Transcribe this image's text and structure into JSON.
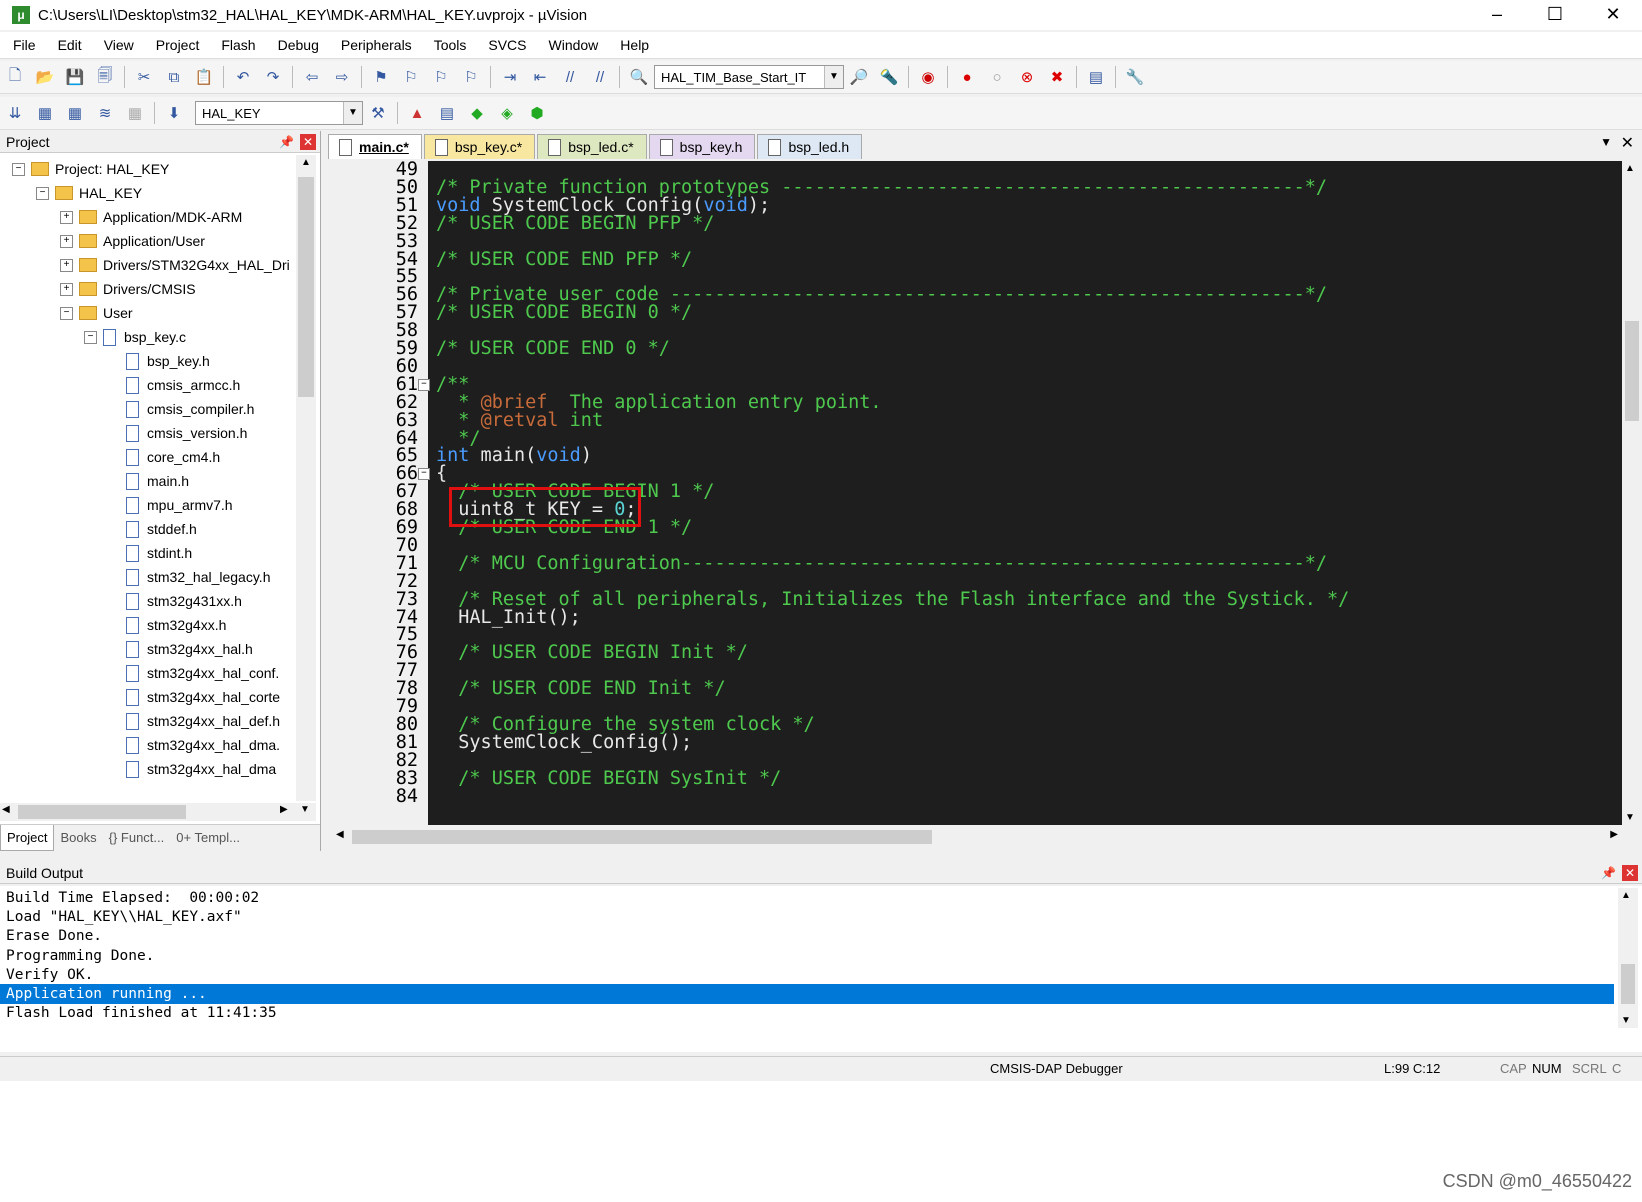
{
  "window": {
    "title": "C:\\Users\\LI\\Desktop\\stm32_HAL\\HAL_KEY\\MDK-ARM\\HAL_KEY.uvprojx - µVision",
    "minimize": "–",
    "maximize": "☐",
    "close": "✕"
  },
  "menu": [
    "File",
    "Edit",
    "View",
    "Project",
    "Flash",
    "Debug",
    "Peripherals",
    "Tools",
    "SVCS",
    "Window",
    "Help"
  ],
  "toolbar": {
    "function_combo": "HAL_TIM_Base_Start_IT",
    "target_combo": "HAL_KEY"
  },
  "project_panel": {
    "title": "Project",
    "tree": [
      {
        "label": "Project: HAL_KEY",
        "level": 0,
        "type": "project",
        "exp": "−"
      },
      {
        "label": "HAL_KEY",
        "level": 1,
        "type": "folder",
        "exp": "−"
      },
      {
        "label": "Application/MDK-ARM",
        "level": 2,
        "type": "folder",
        "exp": "+"
      },
      {
        "label": "Application/User",
        "level": 2,
        "type": "folder",
        "exp": "+"
      },
      {
        "label": "Drivers/STM32G4xx_HAL_Dri",
        "level": 2,
        "type": "folder",
        "exp": "+"
      },
      {
        "label": "Drivers/CMSIS",
        "level": 2,
        "type": "folder",
        "exp": "+"
      },
      {
        "label": "User",
        "level": 2,
        "type": "folder",
        "exp": "−"
      },
      {
        "label": "bsp_key.c",
        "level": 3,
        "type": "file",
        "exp": "−"
      },
      {
        "label": "bsp_key.h",
        "level": 4,
        "type": "file"
      },
      {
        "label": "cmsis_armcc.h",
        "level": 4,
        "type": "file"
      },
      {
        "label": "cmsis_compiler.h",
        "level": 4,
        "type": "file"
      },
      {
        "label": "cmsis_version.h",
        "level": 4,
        "type": "file"
      },
      {
        "label": "core_cm4.h",
        "level": 4,
        "type": "file"
      },
      {
        "label": "main.h",
        "level": 4,
        "type": "file"
      },
      {
        "label": "mpu_armv7.h",
        "level": 4,
        "type": "file"
      },
      {
        "label": "stddef.h",
        "level": 4,
        "type": "file"
      },
      {
        "label": "stdint.h",
        "level": 4,
        "type": "file"
      },
      {
        "label": "stm32_hal_legacy.h",
        "level": 4,
        "type": "file"
      },
      {
        "label": "stm32g431xx.h",
        "level": 4,
        "type": "file"
      },
      {
        "label": "stm32g4xx.h",
        "level": 4,
        "type": "file"
      },
      {
        "label": "stm32g4xx_hal.h",
        "level": 4,
        "type": "file"
      },
      {
        "label": "stm32g4xx_hal_conf.",
        "level": 4,
        "type": "file"
      },
      {
        "label": "stm32g4xx_hal_corte",
        "level": 4,
        "type": "file"
      },
      {
        "label": "stm32g4xx_hal_def.h",
        "level": 4,
        "type": "file"
      },
      {
        "label": "stm32g4xx_hal_dma.",
        "level": 4,
        "type": "file"
      },
      {
        "label": "stm32g4xx_hal_dma",
        "level": 4,
        "type": "file"
      }
    ],
    "tabs": [
      "Project",
      "Books",
      "{} Funct...",
      "0+ Templ..."
    ]
  },
  "editor": {
    "tabs": [
      {
        "label": "main.c*",
        "color": "#f7e7a0",
        "active": true
      },
      {
        "label": "bsp_key.c*",
        "color": "#f7e7a0"
      },
      {
        "label": "bsp_led.c*",
        "color": "#dde8c0"
      },
      {
        "label": "bsp_key.h",
        "color": "#e4d8f0"
      },
      {
        "label": "bsp_led.h",
        "color": "#dde8f4"
      }
    ],
    "lines": [
      {
        "n": "49",
        "fold": "",
        "segs": []
      },
      {
        "n": "50",
        "fold": "",
        "segs": [
          [
            "c-comment",
            "/* Private function prototypes -----------------------------------------------*/"
          ]
        ]
      },
      {
        "n": "51",
        "fold": "",
        "segs": [
          [
            "c-kw",
            "void"
          ],
          [
            "c-plain",
            " SystemClock_Config("
          ],
          [
            "c-kw",
            "void"
          ],
          [
            "c-plain",
            ");"
          ]
        ]
      },
      {
        "n": "52",
        "fold": "",
        "segs": [
          [
            "c-comment",
            "/* USER CODE BEGIN PFP */"
          ]
        ]
      },
      {
        "n": "53",
        "fold": "",
        "segs": []
      },
      {
        "n": "54",
        "fold": "",
        "segs": [
          [
            "c-comment",
            "/* USER CODE END PFP */"
          ]
        ]
      },
      {
        "n": "55",
        "fold": "",
        "segs": []
      },
      {
        "n": "56",
        "fold": "",
        "segs": [
          [
            "c-comment",
            "/* Private user code ---------------------------------------------------------*/"
          ]
        ]
      },
      {
        "n": "57",
        "fold": "",
        "segs": [
          [
            "c-comment",
            "/* USER CODE BEGIN 0 */"
          ]
        ]
      },
      {
        "n": "58",
        "fold": "",
        "segs": []
      },
      {
        "n": "59",
        "fold": "",
        "segs": [
          [
            "c-comment",
            "/* USER CODE END 0 */"
          ]
        ]
      },
      {
        "n": "60",
        "fold": "",
        "segs": []
      },
      {
        "n": "61",
        "fold": "−",
        "segs": [
          [
            "c-comment",
            "/**"
          ]
        ]
      },
      {
        "n": "62",
        "fold": "",
        "segs": [
          [
            "c-comment",
            "  * "
          ],
          [
            "c-tag",
            "@brief"
          ],
          [
            "c-comment",
            "  The application entry point."
          ]
        ]
      },
      {
        "n": "63",
        "fold": "",
        "segs": [
          [
            "c-comment",
            "  * "
          ],
          [
            "c-tag",
            "@retval"
          ],
          [
            "c-comment",
            " int"
          ]
        ]
      },
      {
        "n": "64",
        "fold": "",
        "segs": [
          [
            "c-comment",
            "  */"
          ]
        ]
      },
      {
        "n": "65",
        "fold": "",
        "segs": [
          [
            "c-kw",
            "int"
          ],
          [
            "c-plain",
            " main("
          ],
          [
            "c-kw",
            "void"
          ],
          [
            "c-plain",
            ")"
          ]
        ]
      },
      {
        "n": "66",
        "fold": "−",
        "segs": [
          [
            "c-plain",
            "{"
          ]
        ]
      },
      {
        "n": "67",
        "fold": "",
        "segs": [
          [
            "c-comment",
            "  /* USER CODE BEGIN 1 */"
          ]
        ]
      },
      {
        "n": "68",
        "fold": "",
        "segs": [
          [
            "c-plain",
            "  uint8_t KEY = "
          ],
          [
            "c-num",
            "0"
          ],
          [
            "c-plain",
            ";"
          ]
        ]
      },
      {
        "n": "69",
        "fold": "",
        "segs": [
          [
            "c-comment",
            "  /* USER CODE END 1 */"
          ]
        ]
      },
      {
        "n": "70",
        "fold": "",
        "segs": []
      },
      {
        "n": "71",
        "fold": "",
        "segs": [
          [
            "c-comment",
            "  /* MCU Configuration--------------------------------------------------------*/"
          ]
        ]
      },
      {
        "n": "72",
        "fold": "",
        "segs": []
      },
      {
        "n": "73",
        "fold": "",
        "segs": [
          [
            "c-comment",
            "  /* Reset of all peripherals, Initializes the Flash interface and the Systick. */"
          ]
        ]
      },
      {
        "n": "74",
        "fold": "",
        "segs": [
          [
            "c-plain",
            "  HAL_Init();"
          ]
        ]
      },
      {
        "n": "75",
        "fold": "",
        "segs": []
      },
      {
        "n": "76",
        "fold": "",
        "segs": [
          [
            "c-comment",
            "  /* USER CODE BEGIN Init */"
          ]
        ]
      },
      {
        "n": "77",
        "fold": "",
        "segs": []
      },
      {
        "n": "78",
        "fold": "",
        "segs": [
          [
            "c-comment",
            "  /* USER CODE END Init */"
          ]
        ]
      },
      {
        "n": "79",
        "fold": "",
        "segs": []
      },
      {
        "n": "80",
        "fold": "",
        "segs": [
          [
            "c-comment",
            "  /* Configure the system clock */"
          ]
        ]
      },
      {
        "n": "81",
        "fold": "",
        "segs": [
          [
            "c-plain",
            "  SystemClock_Config();"
          ]
        ]
      },
      {
        "n": "82",
        "fold": "",
        "segs": []
      },
      {
        "n": "83",
        "fold": "",
        "segs": [
          [
            "c-comment",
            "  /* USER CODE BEGIN SysInit */"
          ]
        ]
      },
      {
        "n": "84",
        "fold": "",
        "segs": []
      }
    ]
  },
  "build_output": {
    "title": "Build Output",
    "lines": [
      "Build Time Elapsed:  00:00:02",
      "Load \"HAL_KEY\\\\HAL_KEY.axf\"",
      "Erase Done.",
      "Programming Done.",
      "Verify OK.",
      "Application running ...",
      "Flash Load finished at 11:41:35"
    ],
    "selected_index": 5
  },
  "status": {
    "debugger": "CMSIS-DAP Debugger",
    "position": "L:99 C:12",
    "cap": "CAP",
    "num": "NUM",
    "scrl": "SCRL",
    "ovr": "C"
  },
  "watermark": "CSDN @m0_46550422"
}
